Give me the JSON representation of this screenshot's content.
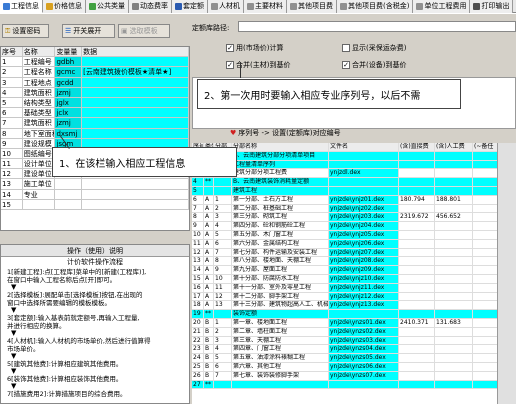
{
  "tabs": [
    {
      "label": "工程信息",
      "color": "#3a7bd5"
    },
    {
      "label": "价格信息",
      "color": "#d8a020"
    },
    {
      "label": "公共类量",
      "color": "#40a040"
    },
    {
      "label": "动态费率",
      "color": "#808080"
    },
    {
      "label": "套定额",
      "color": "#2a5ab0"
    },
    {
      "label": "人材机",
      "color": "#909090"
    },
    {
      "label": "主要材料",
      "color": "#909090"
    },
    {
      "label": "其他项目费",
      "color": "#909090"
    },
    {
      "label": "其他项目费(含税金)",
      "color": "#909090"
    },
    {
      "label": "单位工程费用",
      "color": "#909090"
    },
    {
      "label": "打印输出",
      "color": "#505050"
    }
  ],
  "toolbar": {
    "set_password": "设置密码",
    "expand_collapse": "开关展开",
    "select_template": "选取模板"
  },
  "left_table": {
    "headers": [
      "序号",
      "名称",
      "变量量",
      "数据"
    ],
    "rows": [
      [
        "1",
        "工程编号",
        "gdbh",
        ""
      ],
      [
        "2",
        "工程名称",
        "gcmc",
        "[云南建筑拨价模板★清单★]"
      ],
      [
        "3",
        "工程地点",
        "gcdd",
        ""
      ],
      [
        "4",
        "建筑面积",
        "jzmj",
        ""
      ],
      [
        "5",
        "结构类型",
        "jglx",
        ""
      ],
      [
        "6",
        "基础类型",
        "jclx",
        ""
      ],
      [
        "7",
        "建筑面积",
        "jzmj",
        ""
      ],
      [
        "8",
        "地下室面积",
        "dxsmj",
        ""
      ],
      [
        "9",
        "建设规模",
        "jsgm",
        ""
      ],
      [
        "10",
        "图纸编号",
        "tzbh",
        ""
      ],
      [
        "11",
        "设计单位",
        "",
        ""
      ],
      [
        "12",
        "建设单位",
        "",
        ""
      ],
      [
        "13",
        "施工单位",
        "",
        ""
      ],
      [
        "14",
        "专业",
        "",
        ""
      ],
      [
        "15",
        "",
        "",
        ""
      ]
    ]
  },
  "instructions": {
    "title": "操作（使用）说明",
    "subtitle": "计价软件操作流程",
    "steps": [
      "1[新建工程]:点[工程库]菜单中的[新建(工程库)],\n在窗口中输入工程名称后点[开]即可。",
      "2[选择模板]:展配单击[选择模板]按钮,在出现的\n窗口中选择所需要编辑的模板模板。",
      "3[套定额]:输入基表前就定额号,再输入工程量,\n并进行相应的换算。",
      "4[人材机]:输入人材机的市场单价,然后进行值算得\n市场单价。",
      "5[建筑其他费]:计算相应建筑其他费用。",
      "6[装饰其他费]:计算相应装饰其他费用。",
      "7[措施费用2]:计算措施项目的综合费用。"
    ]
  },
  "right_panel": {
    "dingeku_label": "定额库路径:",
    "checkbox_labels": [
      "用(市场价)计算",
      "显示(采保运杂费)",
      "合并(主材)到基价",
      "合并(设备)到基价"
    ],
    "checkbox_states": [
      true,
      false,
      true,
      true
    ],
    "sequence_title": "序列号 -> 设置(定额库)对应编号"
  },
  "callouts": {
    "top": "2、第一次用时要输入相应专业序列号，以后不需",
    "left": "1、在该栏输入相应工程信息"
  },
  "right_table": {
    "headers": [
      "序号",
      "类型",
      "分部",
      "分部名称",
      "文件名",
      "(含)直接费",
      "(含)人工费",
      ""
    ],
    "headers_extra": "(~备任",
    "rows": [
      {
        "cells": [
          "1",
          "**",
          "",
          "A、云南建筑分部分项清单项目",
          "",
          "",
          ""
        ],
        "style": "cyan"
      },
      {
        "cells": [
          "2",
          "",
          "",
          "工程量清单序列",
          "",
          "",
          ""
        ],
        "style": "cyan"
      },
      {
        "cells": [
          "3",
          "",
          "",
          "建筑分部分项工程费",
          "ynjzdl.dex",
          "",
          ""
        ],
        "style": "plain"
      },
      {
        "cells": [
          "4",
          "**",
          "",
          "B、云南建筑装饰消耗量定额",
          "",
          "",
          ""
        ],
        "style": "cyan"
      },
      {
        "cells": [
          "5",
          "",
          "",
          "建筑工程",
          "",
          "",
          ""
        ],
        "style": "cyan"
      },
      {
        "cells": [
          "6",
          "A",
          "1",
          "第一分部、土石方工程",
          "ynjzde\\ynjz01.dex",
          "180.794",
          "188.801"
        ],
        "style": "plain"
      },
      {
        "cells": [
          "7",
          "A",
          "2",
          "第二分部、桩基础工程",
          "ynjzde\\ynjz02.dex",
          "",
          ""
        ],
        "style": "plain"
      },
      {
        "cells": [
          "8",
          "A",
          "3",
          "第三分部、砌筑工程",
          "ynjzde\\ynjz03.dex",
          "2319.672",
          "456.652"
        ],
        "style": "plain"
      },
      {
        "cells": [
          "9",
          "A",
          "4",
          "第四分部、砼和钢筋砼工程",
          "ynjzde\\ynjz04.dex",
          "",
          ""
        ],
        "style": "plain"
      },
      {
        "cells": [
          "10",
          "A",
          "5",
          "第五分部、木门窗工程",
          "ynjzde\\ynjz05.dex",
          "",
          ""
        ],
        "style": "plain"
      },
      {
        "cells": [
          "11",
          "A",
          "6",
          "第六分部、金属结构工程",
          "ynjzde\\ynjz06.dex",
          "",
          ""
        ],
        "style": "plain"
      },
      {
        "cells": [
          "12",
          "A",
          "7",
          "第七分部、构件运输及安装工程",
          "ynjzde\\ynjz07.dex",
          "",
          ""
        ],
        "style": "plain"
      },
      {
        "cells": [
          "13",
          "A",
          "8",
          "第八分部、楼地面、天棚工程",
          "ynjzde\\ynjz08.dex",
          "",
          ""
        ],
        "style": "plain"
      },
      {
        "cells": [
          "14",
          "A",
          "9",
          "第九分部、屋面工程",
          "ynjzde\\ynjz09.dex",
          "",
          ""
        ],
        "style": "plain"
      },
      {
        "cells": [
          "15",
          "A",
          "10",
          "第十分部、防腐防水工程",
          "ynjzde\\ynjz10.dex",
          "",
          ""
        ],
        "style": "plain"
      },
      {
        "cells": [
          "16",
          "A",
          "11",
          "第十一分部、室外及零星工程",
          "ynjzde\\ynjz11.dex",
          "",
          ""
        ],
        "style": "plain"
      },
      {
        "cells": [
          "17",
          "A",
          "12",
          "第十二分部、脚手架工程",
          "ynjzde\\ynjz12.dex",
          "",
          ""
        ],
        "style": "plain"
      },
      {
        "cells": [
          "18",
          "A",
          "13",
          "第十三分部、建筑物超高人工、机械",
          "ynjzde\\ynjz13.dex",
          "",
          ""
        ],
        "style": "plain"
      },
      {
        "cells": [
          "19",
          "**",
          "",
          "装饰定额",
          "",
          "",
          ""
        ],
        "style": "cyan"
      },
      {
        "cells": [
          "20",
          "B",
          "1",
          "第一章、楼地面工程",
          "ynjzde\\ynzs01.dex",
          "2410.371",
          "131.683"
        ],
        "style": "plain"
      },
      {
        "cells": [
          "21",
          "B",
          "2",
          "第二章、墙柱面工程",
          "ynjzde\\ynzs02.dex",
          "",
          ""
        ],
        "style": "plain"
      },
      {
        "cells": [
          "22",
          "B",
          "3",
          "第三章、天棚工程",
          "ynjzde\\ynzs03.dex",
          "",
          ""
        ],
        "style": "plain"
      },
      {
        "cells": [
          "23",
          "B",
          "4",
          "第四章、门窗工程",
          "ynjzde\\ynzs04.dex",
          "",
          ""
        ],
        "style": "plain"
      },
      {
        "cells": [
          "24",
          "B",
          "5",
          "第五章、油漆涂料裱糊工程",
          "ynjzde\\ynzs05.dex",
          "",
          ""
        ],
        "style": "plain"
      },
      {
        "cells": [
          "25",
          "B",
          "6",
          "第六章、其他工程",
          "ynjzde\\ynzs06.dex",
          "",
          ""
        ],
        "style": "plain"
      },
      {
        "cells": [
          "26",
          "B",
          "7",
          "第七章、装饰装修脚手架",
          "ynjzde\\ynzs07.dex",
          "",
          ""
        ],
        "style": "plain"
      },
      {
        "cells": [
          "27",
          "**",
          "",
          "",
          "",
          "",
          ""
        ],
        "style": "cyan"
      }
    ]
  }
}
